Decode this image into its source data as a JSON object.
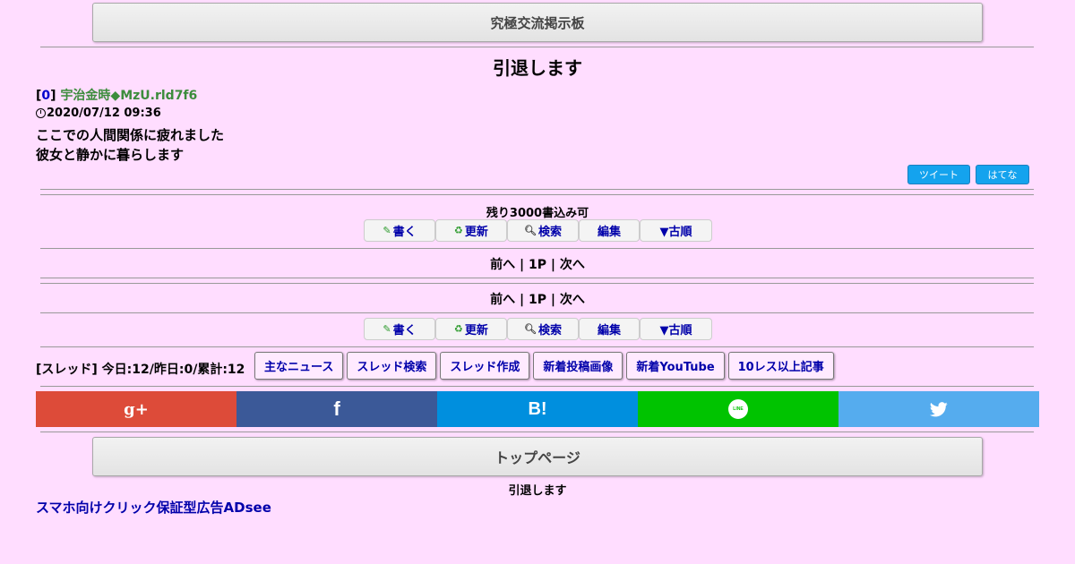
{
  "site": {
    "name": "究極交流掲示板"
  },
  "thread": {
    "title": "引退します"
  },
  "post": {
    "number": "0",
    "author": "宇治金時◆MzU.rld7f6",
    "date": "2020/07/12 09:36",
    "lines": [
      "ここでの人間関係に疲れました",
      "彼女と静かに暮らします"
    ]
  },
  "share_small": {
    "tweet": "ツイート",
    "hatena": "はてな"
  },
  "remaining": "残り3000書込み可",
  "actions": {
    "write": "書く",
    "refresh": "更新",
    "search": "検索",
    "edit": "編集",
    "order": "▼古順"
  },
  "pager": {
    "prev": "前へ",
    "page": "1P",
    "next": "次へ",
    "sep": "|"
  },
  "stats": "[スレッド] 今日:12/昨日:0/累計:12",
  "links": [
    "主なニュース",
    "スレッド検索",
    "スレッド作成",
    "新着投稿画像",
    "新着YouTube",
    "10レス以上記事"
  ],
  "social": {
    "gplus": "g+",
    "facebook": "f",
    "hatena": "B!",
    "line": "LINE",
    "colors": {
      "gplus": "#dd4b39",
      "facebook": "#3b5998",
      "hatena": "#008fde",
      "line": "#00c300",
      "twitter": "#55acee"
    }
  },
  "top_page": "トップページ",
  "footer_title": "引退します",
  "ad_link": "スマホ向けクリック保証型広告ADsee"
}
